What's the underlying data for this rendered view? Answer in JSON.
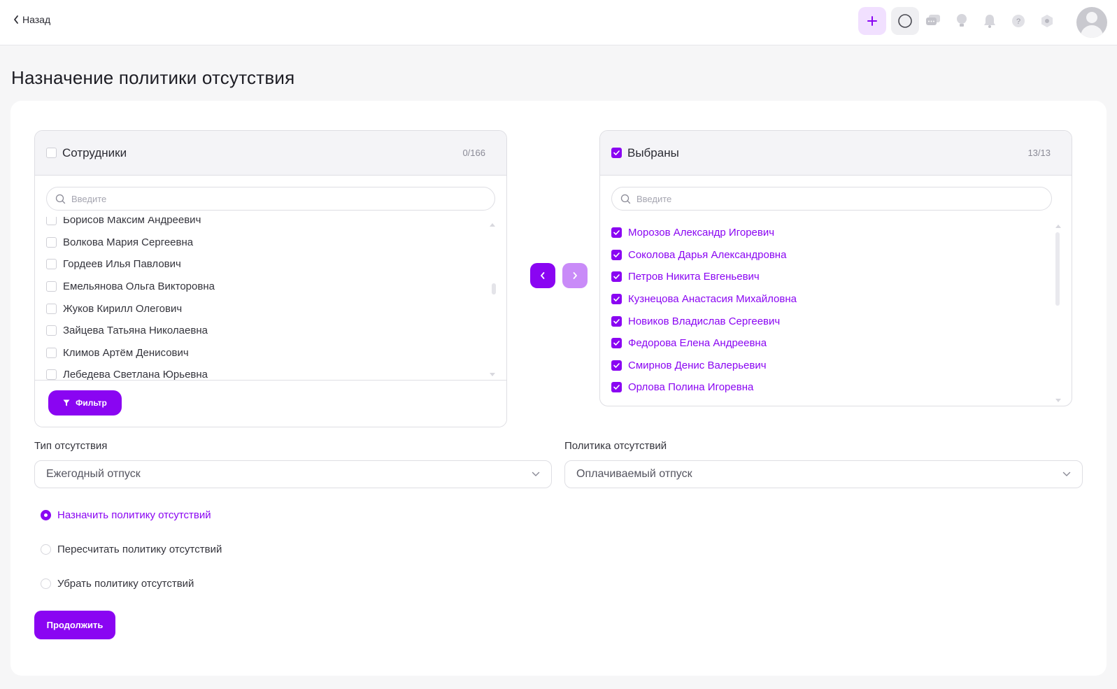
{
  "topbar": {
    "back_label": "Назад",
    "icons": [
      "plus-icon",
      "search-icon",
      "chat-icon",
      "idea-icon",
      "bell-icon",
      "help-icon",
      "settings-icon",
      "avatar"
    ]
  },
  "page": {
    "title": "Назначение политики отсутствия"
  },
  "employees_panel": {
    "title": "Сотрудники",
    "count": "0/166",
    "search_placeholder": "Введите",
    "items": [
      "Борисов Максим Андреевич",
      "Волкова Мария Сергеевна",
      "Гордеев Илья Павлович",
      "Емельянова Ольга Викторовна",
      "Жуков Кирилл Олегович",
      "Зайцева Татьяна Николаевна",
      "Климов Артём Денисович",
      "Лебедева Светлана Юрьевна"
    ],
    "filter_label": "Фильтр"
  },
  "selected_panel": {
    "title": "Выбраны",
    "count": "13/13",
    "search_placeholder": "Введите",
    "items": [
      "Морозов Александр Игоревич",
      "Соколова Дарья Александровна",
      "Петров Никита Евгеньевич",
      "Кузнецова Анастасия Михайловна",
      "Новиков Владислав Сергеевич",
      "Федорова Елена Андреевна",
      "Смирнов Денис Валерьевич",
      "Орлова Полина Игоревна"
    ]
  },
  "form": {
    "absence_type_label": "Тип отсутствия",
    "absence_type_value": "Ежегодный отпуск",
    "policy_label": "Политика отсутствий",
    "policy_value": "Оплачиваемый отпуск",
    "radio_options": [
      {
        "label": "Назначить политику отсутствий",
        "selected": true
      },
      {
        "label": "Пересчитать политику отсутствий",
        "selected": false
      },
      {
        "label": "Убрать политику отсутствий",
        "selected": false
      }
    ],
    "continue_label": "Продолжить"
  },
  "colors": {
    "accent": "#8a05f2",
    "accent_light": "#c98bf8",
    "panel_header": "#f4f4f7"
  }
}
